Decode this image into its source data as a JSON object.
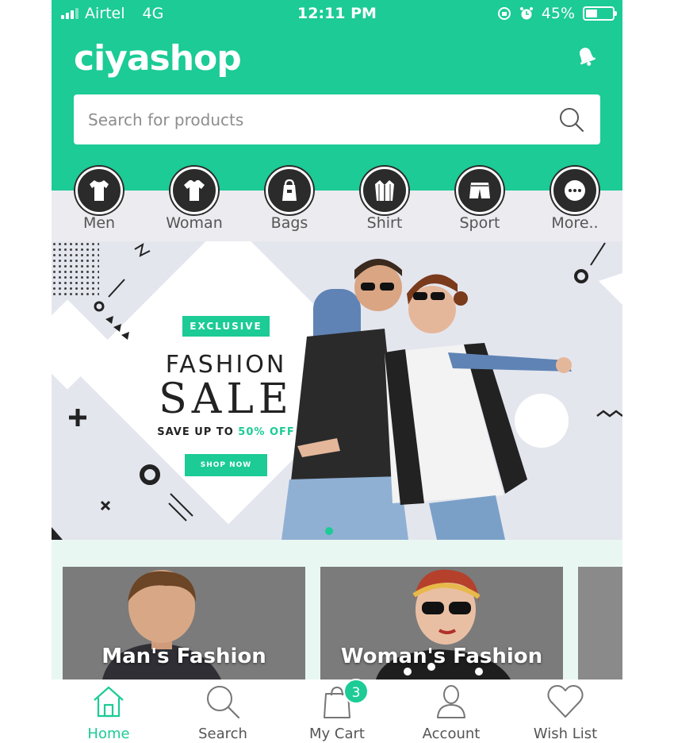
{
  "colors": {
    "brand": "#1ccb95",
    "icon_dark": "#2b2b2b",
    "strip": "#ebebf0"
  },
  "status_bar": {
    "carrier": "Airtel",
    "network": "4G",
    "time": "12:11 PM",
    "battery": "45%",
    "battery_level": 0.45
  },
  "header": {
    "logo": "ciyashop",
    "bell_icon": "bell-icon"
  },
  "search": {
    "placeholder": "Search for products",
    "value": "",
    "icon": "search-icon"
  },
  "categories": [
    {
      "label": "Men",
      "icon": "tshirt-icon"
    },
    {
      "label": "Woman",
      "icon": "top-icon"
    },
    {
      "label": "Bags",
      "icon": "bag-icon"
    },
    {
      "label": "Shirt",
      "icon": "shirt-icon"
    },
    {
      "label": "Sport",
      "icon": "shorts-icon"
    },
    {
      "label": "More..",
      "icon": "more-icon"
    }
  ],
  "banner": {
    "badge": "EXCLUSIVE",
    "line1": "FASHION",
    "line2": "SALE",
    "save_prefix": "SAVE UP TO ",
    "save_highlight": "50% OFF",
    "cta": "SHOP NOW"
  },
  "cards": [
    {
      "title": "Man's Fashion"
    },
    {
      "title": "Woman's Fashion"
    }
  ],
  "tabbar": {
    "items": [
      {
        "label": "Home",
        "icon": "home-icon",
        "active": true
      },
      {
        "label": "Search",
        "icon": "search-icon",
        "active": false
      },
      {
        "label": "My Cart",
        "icon": "cart-bag-icon",
        "active": false
      },
      {
        "label": "Account",
        "icon": "account-icon",
        "active": false
      },
      {
        "label": "Wish List",
        "icon": "heart-icon",
        "active": false
      }
    ],
    "cart_count": "3"
  }
}
